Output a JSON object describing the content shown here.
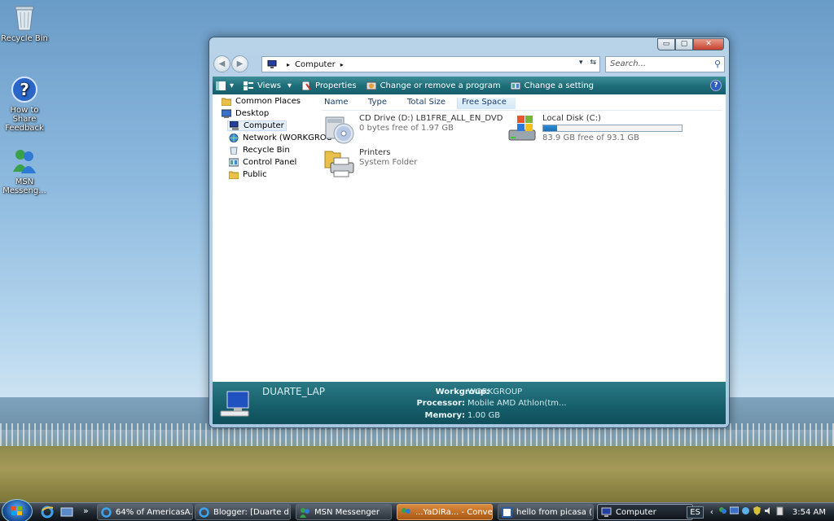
{
  "desktop": {
    "icons": [
      {
        "label": "Recycle Bin",
        "icon": "recycle-bin-icon"
      },
      {
        "label": "How to Share Feedback",
        "icon": "help-feedback-icon"
      },
      {
        "label": "MSN Messeng...",
        "icon": "msn-messenger-icon"
      }
    ]
  },
  "window": {
    "title_buttons": {
      "minimize": "▭",
      "maximize": "▢",
      "close": "✕"
    },
    "nav": {
      "back": "◀",
      "forward": "▶"
    },
    "address": {
      "crumb": "Computer",
      "sep1": "▸",
      "sep2": "▸",
      "dropdown": "▾",
      "refresh": "⇆"
    },
    "search": {
      "placeholder": "Search..."
    },
    "toolbar": {
      "organize_arrow": "▾",
      "views_label": "Views",
      "views_arrow": "▾",
      "properties_label": "Properties",
      "change_program_label": "Change or remove a program",
      "change_setting_label": "Change a setting",
      "help": "?"
    },
    "nav_pane": {
      "items": [
        {
          "label": "Common Places",
          "icon": "folder-icon"
        },
        {
          "label": "Desktop",
          "icon": "desktop-icon"
        },
        {
          "label": "Computer",
          "icon": "computer-icon",
          "selected": true
        },
        {
          "label": "Network (WORKGROU",
          "icon": "network-icon"
        },
        {
          "label": "Recycle Bin",
          "icon": "recycle-bin-icon"
        },
        {
          "label": "Control Panel",
          "icon": "control-panel-icon"
        },
        {
          "label": "Public",
          "icon": "folder-icon"
        }
      ]
    },
    "columns": [
      "Name",
      "Type",
      "Total Size",
      "Free Space"
    ],
    "items": [
      {
        "name": "CD Drive (D:) LB1FRE_ALL_EN_DVD",
        "sub": "0 bytes free of 1.97 GB",
        "icon": "cd-drive-icon"
      },
      {
        "name": "Local Disk (C:)",
        "sub": "83.9 GB free of 93.1 GB",
        "icon": "local-disk-icon",
        "used_fraction": 0.1
      },
      {
        "name": "Printers",
        "sub": "System Folder",
        "icon": "printers-folder-icon"
      }
    ],
    "details": {
      "computer_name": "DUARTE_LAP",
      "workgroup_label": "Workgroup:",
      "workgroup_value": "WORKGROUP",
      "processor_label": "Processor:",
      "processor_value": "Mobile AMD Athlon(tm...",
      "memory_label": "Memory:",
      "memory_value": "1.00 GB"
    }
  },
  "taskbar": {
    "chevron": "»",
    "tasks": [
      {
        "label": "64% of AmericasA...",
        "icon": "ie-icon"
      },
      {
        "label": "Blogger: [Duarte d...",
        "icon": "ie-icon"
      },
      {
        "label": "MSN Messenger",
        "icon": "msn-messenger-icon"
      },
      {
        "label": "...YaDiRa... - Conve...",
        "icon": "msn-conversation-icon"
      },
      {
        "label": "hello from picasa (...",
        "icon": "picasa-icon"
      },
      {
        "label": "Computer",
        "icon": "computer-icon"
      }
    ],
    "tray": {
      "lang": "ES",
      "arrow": "‹",
      "clock": "3:54 AM"
    }
  }
}
